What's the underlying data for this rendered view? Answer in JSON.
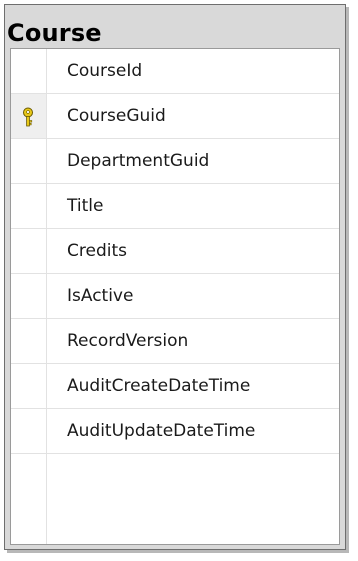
{
  "table": {
    "name": "Course",
    "columns": [
      {
        "name": "CourseId",
        "primary_key": false
      },
      {
        "name": "CourseGuid",
        "primary_key": true
      },
      {
        "name": "DepartmentGuid",
        "primary_key": false
      },
      {
        "name": "Title",
        "primary_key": false
      },
      {
        "name": "Credits",
        "primary_key": false
      },
      {
        "name": "IsActive",
        "primary_key": false
      },
      {
        "name": "RecordVersion",
        "primary_key": false
      },
      {
        "name": "AuditCreateDateTime",
        "primary_key": false
      },
      {
        "name": "AuditUpdateDateTime",
        "primary_key": false
      }
    ]
  },
  "icons": {
    "primary_key": "key-icon"
  },
  "colors": {
    "box_background": "#d9d9d9",
    "grid_background": "#ffffff",
    "key_icon_fill": "#e8c818",
    "key_icon_stroke": "#6a5a00"
  }
}
